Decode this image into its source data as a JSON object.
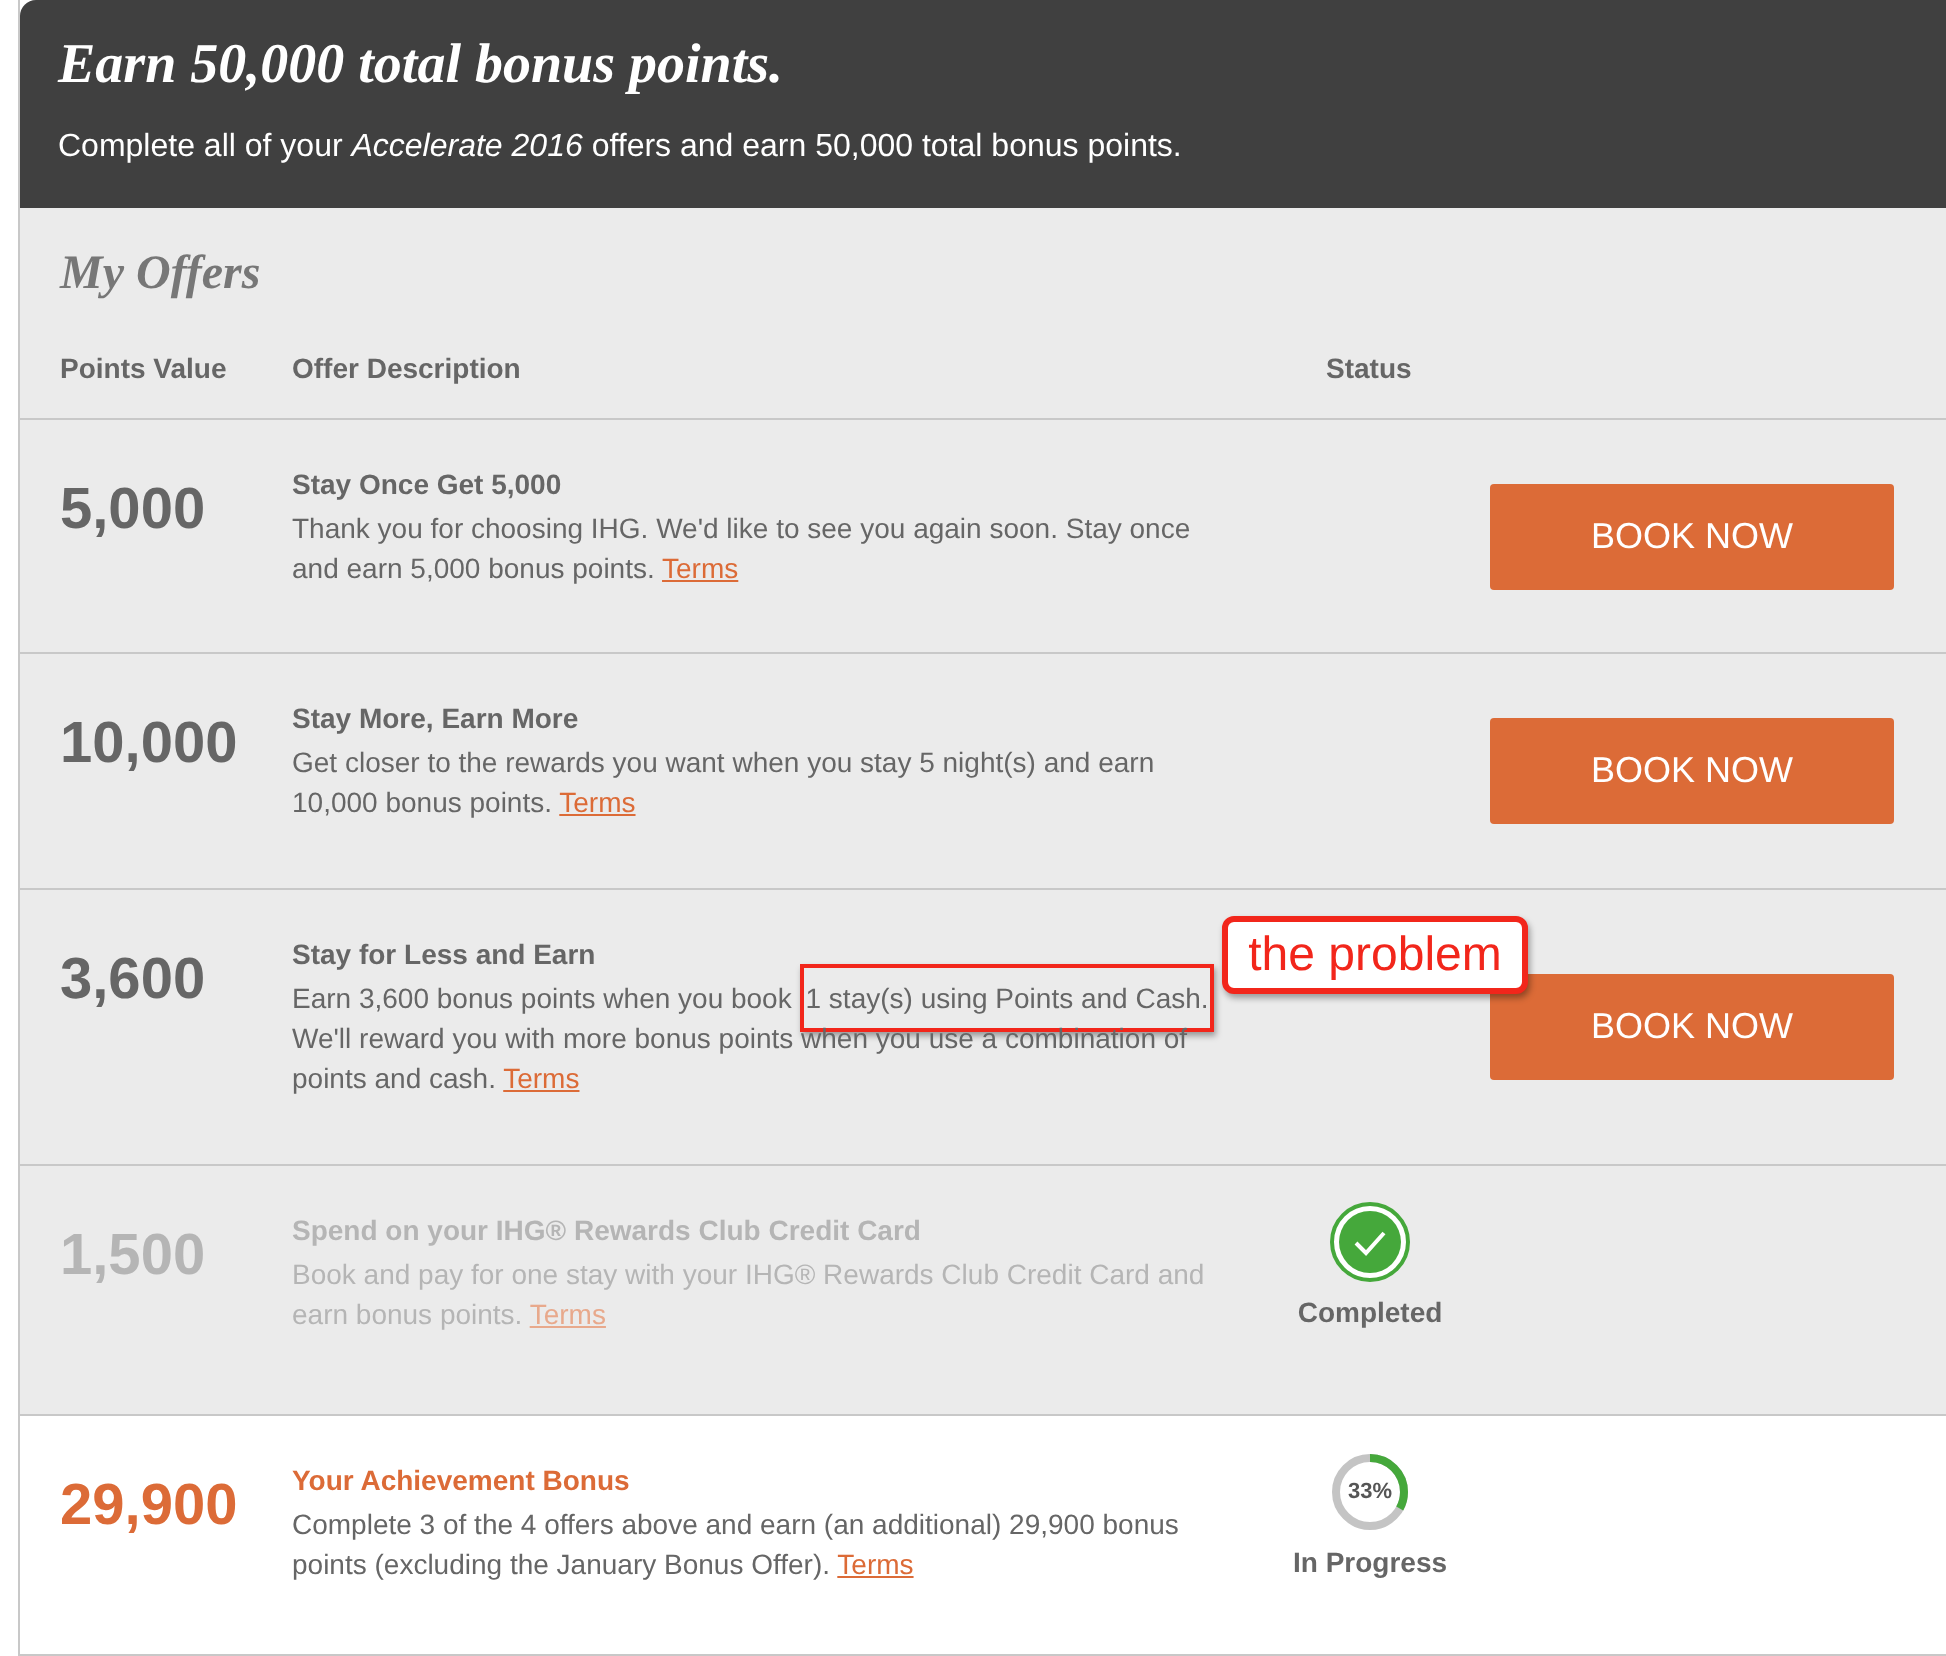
{
  "banner": {
    "title": "Earn 50,000 total bonus points.",
    "subtitle": "Complete all of your *Accelerate 2016* offers and earn 50,000 total bonus points."
  },
  "section_title": "My Offers",
  "columns": [
    "Points Value",
    "Offer Description",
    "Status"
  ],
  "offers": [
    {
      "kind": "book",
      "disabled": false,
      "highlighted": false,
      "points": "5,000",
      "title": "Stay Once Get 5,000",
      "description": "Thank you for choosing IHG. We'd like to see you again soon. Stay once and earn 5,000 bonus points.",
      "terms": "Terms",
      "button": "BOOK NOW"
    },
    {
      "kind": "book",
      "disabled": false,
      "highlighted": false,
      "points": "10,000",
      "title": "Stay More, Earn More",
      "description": "Get closer to the rewards you want when you stay 5 night(s) and earn 10,000 bonus points.",
      "terms": "Terms",
      "button": "BOOK NOW"
    },
    {
      "kind": "book",
      "disabled": false,
      "highlighted": false,
      "points": "3,600",
      "title": "Stay for Less and Earn",
      "description": "Earn 3,600 bonus points when you book",
      "highlight": "1 stay(s) using Points and Cash.",
      "description_end": "We'll reward you with more bonus points when you use a combination of points and cash.",
      "terms": "Terms",
      "button": "BOOK NOW",
      "annotation": "the problem"
    },
    {
      "kind": "completed",
      "disabled": true,
      "highlighted": false,
      "points": "1,500",
      "title": "Spend on your IHG® Rewards Club Credit Card",
      "description": "Book and pay for one stay with your IHG® Rewards Club Credit Card and earn bonus points.",
      "terms": "Terms",
      "status": "Completed"
    },
    {
      "kind": "progress",
      "disabled": false,
      "highlighted": true,
      "points": "29,900",
      "title": "Your Achievement Bonus",
      "description": "Complete 3 of the 4 offers above and earn (an additional) 29,900 bonus points (excluding the January Bonus Offer).",
      "terms": "Terms",
      "status": "In Progress",
      "level": 0.33,
      "percent": "33%"
    }
  ]
}
